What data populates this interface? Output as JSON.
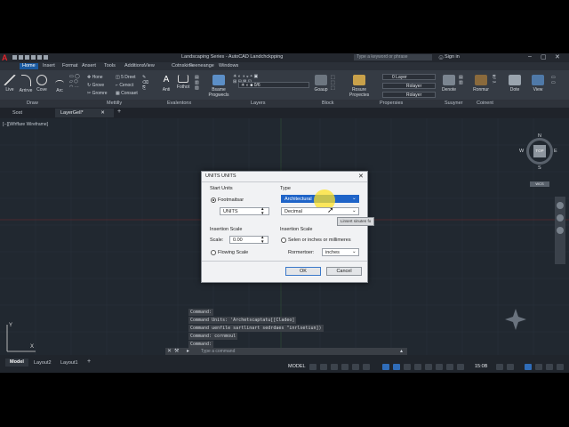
{
  "app": {
    "logo": "A",
    "title": "Landscaping Series - AutoCAD Landchckpping",
    "search_placeholder": "Type a keyword or phrase",
    "sign_in": "Sign in"
  },
  "ribbon_tabs": [
    "Home",
    "Insert",
    "Format",
    "Ansert",
    "Tools",
    "Additions",
    "View",
    "Cotnskins",
    "Feeneange",
    "Windows"
  ],
  "ribbon": {
    "draw_buttons": [
      "Live",
      "Arrirve",
      "Cove",
      "Arc"
    ],
    "modify_items": [
      "Hone",
      "Grove",
      "Gromre",
      "5 Dreet",
      "Cenoct",
      "Consaet"
    ],
    "annotation_buttons": [
      "Anti",
      "Fothot"
    ],
    "block_buttons": [
      "Bsame Progwecls"
    ],
    "layer_value": "0 Layer",
    "bylayer_1": "Rolayer",
    "bylayer_2": "Rolayer",
    "props_button": "Rosure Proyectes",
    "groups_button": "Goaup",
    "utilities_buttons": [
      "Denote"
    ],
    "clipboard_buttons": [
      "Ronmur"
    ],
    "view_buttons": [
      "Dote",
      "View"
    ],
    "group_labels": [
      "Draw",
      "Mettilly",
      "Evalentonx",
      "Layers",
      "Block",
      "Propersies",
      "Suuyner",
      "Coinent"
    ]
  },
  "doc_tabs": [
    "Sost",
    "LayerGell*"
  ],
  "viewport_label": "[--][Wfrffare Wireframe]",
  "viewcube": {
    "top": "TOP",
    "n": "N",
    "s": "S",
    "e": "E",
    "w": "W",
    "wcs": "WCS"
  },
  "dialog": {
    "title": "UNITS UNITS",
    "start_units_label": "Start Units",
    "radio_current": "Footmaitsar",
    "start_units_value": "UNITS",
    "type_label": "Type",
    "type_value": "Architectural",
    "type_value_2": "Decimal",
    "tooltip": "Linsert sinuten fo",
    "insertion_scale_label_left": "Insertion Scale",
    "scale_label": "Scale:",
    "scale_value": "0.00",
    "radio_flowing": "Flowing Scale",
    "insertion_scale_label_right": "Insertion Scale",
    "radio_select": "Selen or inches or millimeres",
    "format_label": "Rormertoer:",
    "format_value": "inches",
    "ok_label": "OK",
    "cancel_label": "Cancel"
  },
  "command_history": [
    "Command:",
    "Command Units: 'Archetscaptatu[[Cladeo]",
    "Command uenfile sartlinart sedrdaes \"inrlsetiun])",
    "Command: cornmoul",
    "Command:"
  ],
  "command_placeholder": "Type a command",
  "layout_tabs": [
    "Model",
    "Layout2",
    "Layout1"
  ],
  "status": {
    "model": "MODEL",
    "zoom": "15:0B"
  },
  "colors": {
    "accent": "#1b5aa0",
    "canvas": "#212830"
  }
}
